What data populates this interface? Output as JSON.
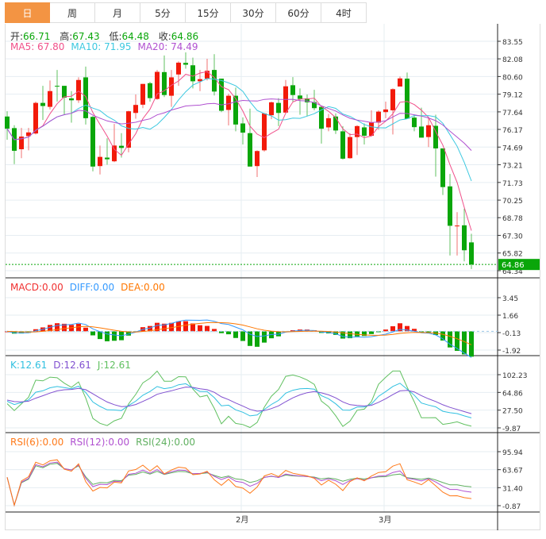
{
  "tabs": [
    {
      "label": "日",
      "active": true
    },
    {
      "label": "周"
    },
    {
      "label": "月"
    },
    {
      "label": "5分"
    },
    {
      "label": "15分"
    },
    {
      "label": "30分"
    },
    {
      "label": "60分"
    },
    {
      "label": "4时"
    }
  ],
  "ohlc_legend": {
    "open_label": "开:",
    "open": "66.71",
    "high_label": "高:",
    "high": "67.43",
    "low_label": "低:",
    "low": "64.48",
    "close_label": "收:",
    "close": "64.86"
  },
  "ma_legend": {
    "ma5": "MA5: 67.80",
    "ma10": "MA10: 71.95",
    "ma20": "MA20: 74.49"
  },
  "macd_legend": {
    "macd": "MACD:0.00",
    "diff": "DIFF:0.00",
    "dea": "DEA:0.00"
  },
  "kdj_legend": {
    "k": "K:12.61",
    "d": "D:12.61",
    "j": "J:12.61"
  },
  "rsi_legend": {
    "rsi6": "RSI(6):0.00",
    "rsi12": "RSI(12):0.00",
    "rsi24": "RSI(24):0.00"
  },
  "colors": {
    "up": "#f21a0a",
    "down": "#0aa60a",
    "accent": "#f39443",
    "ma5": "#f0508a",
    "ma10": "#3cc8e0",
    "ma20": "#b050d0",
    "diff": "#3399ff",
    "dea": "#ff7700",
    "k": "#30c0e0",
    "d": "#8050d0",
    "j": "#60c060",
    "rsi6": "#ff7a1a",
    "rsi12": "#b050d0",
    "rsi24": "#60b060"
  },
  "chart_data": {
    "type": "candlestick",
    "price_ticks": [
      "83.55",
      "82.08",
      "80.60",
      "79.12",
      "77.64",
      "76.17",
      "74.69",
      "73.21",
      "71.73",
      "70.25",
      "68.78",
      "67.30",
      "65.82",
      "64.34"
    ],
    "last_price": "64.86",
    "macd_ticks": [
      "3.45",
      "1.66",
      "-0.13",
      "-1.92"
    ],
    "kdj_ticks": [
      "102.23",
      "64.86",
      "27.50",
      "-9.87"
    ],
    "rsi_ticks": [
      "95.94",
      "63.67",
      "31.40",
      "-0.87"
    ],
    "x_ticks": [
      {
        "label": "2月",
        "index": 32
      },
      {
        "label": "3月",
        "index": 52
      }
    ],
    "candles": [
      [
        77.25,
        77.69,
        75.31,
        76.23
      ],
      [
        76.28,
        76.52,
        73.26,
        74.38
      ],
      [
        74.51,
        76.3,
        73.76,
        75.57
      ],
      [
        75.61,
        76.3,
        74.42,
        75.92
      ],
      [
        75.83,
        78.5,
        75.75,
        78.39
      ],
      [
        78.39,
        79.82,
        76.96,
        78.13
      ],
      [
        78.06,
        80.27,
        77.84,
        79.38
      ],
      [
        79.82,
        81.15,
        78.5,
        79.78
      ],
      [
        79.82,
        79.82,
        77.4,
        78.83
      ],
      [
        78.77,
        79.38,
        76.74,
        78.61
      ],
      [
        78.61,
        80.53,
        78.39,
        80.31
      ],
      [
        80.53,
        81.43,
        76.58,
        77.11
      ],
      [
        77.22,
        77.29,
        72.66,
        73.06
      ],
      [
        73.1,
        74.82,
        72.4,
        73.87
      ],
      [
        73.81,
        75.42,
        73.21,
        73.67
      ],
      [
        73.5,
        76.63,
        73.43,
        74.82
      ],
      [
        74.8,
        75.86,
        73.81,
        74.62
      ],
      [
        74.64,
        77.73,
        74.25,
        77.69
      ],
      [
        77.55,
        79.1,
        77.07,
        78.22
      ],
      [
        78.24,
        79.98,
        77.95,
        79.98
      ],
      [
        80.04,
        80.15,
        78.5,
        78.79
      ],
      [
        78.72,
        81.15,
        78.66,
        80.99
      ],
      [
        80.97,
        82.36,
        78.88,
        79.05
      ],
      [
        78.99,
        81.15,
        78.06,
        80.53
      ],
      [
        80.77,
        81.87,
        79.82,
        81.76
      ],
      [
        81.74,
        82.62,
        81.26,
        81.59
      ],
      [
        81.54,
        82.18,
        79.6,
        80.2
      ],
      [
        80.2,
        81.15,
        79.38,
        80.38
      ],
      [
        80.42,
        82.09,
        80.27,
        81.08
      ],
      [
        81.15,
        82.47,
        79.01,
        79.34
      ],
      [
        80.42,
        80.42,
        77.62,
        77.73
      ],
      [
        77.8,
        79.16,
        76.5,
        78.99
      ],
      [
        78.99,
        79.67,
        76.01,
        76.58
      ],
      [
        76.67,
        77.18,
        74.91,
        75.9
      ],
      [
        75.86,
        77.91,
        73.06,
        73.06
      ],
      [
        73.1,
        74.42,
        72.18,
        74.36
      ],
      [
        74.42,
        77.55,
        74.31,
        77.51
      ],
      [
        77.36,
        78.5,
        77.03,
        78.44
      ],
      [
        78.39,
        78.79,
        76.45,
        77.55
      ],
      [
        77.58,
        80.31,
        77.51,
        79.78
      ],
      [
        79.87,
        80.55,
        78.5,
        79.05
      ],
      [
        79.01,
        79.6,
        77.4,
        78.72
      ],
      [
        78.77,
        79.1,
        77.29,
        78.44
      ],
      [
        78.46,
        79.49,
        77.77,
        77.95
      ],
      [
        78.06,
        78.13,
        74.98,
        76.23
      ],
      [
        76.34,
        77.47,
        76.01,
        77.11
      ],
      [
        77.25,
        77.51,
        75.79,
        76.08
      ],
      [
        76.01,
        76.45,
        73.65,
        73.72
      ],
      [
        73.76,
        75.86,
        73.72,
        75.53
      ],
      [
        75.53,
        76.52,
        74.03,
        76.45
      ],
      [
        76.34,
        76.67,
        74.91,
        75.64
      ],
      [
        75.64,
        77.77,
        75.57,
        76.74
      ],
      [
        76.74,
        77.77,
        76.14,
        77.66
      ],
      [
        77.62,
        78.5,
        77.11,
        77.84
      ],
      [
        77.77,
        79.6,
        75.75,
        79.54
      ],
      [
        79.76,
        80.6,
        79.76,
        80.44
      ],
      [
        80.42,
        80.93,
        77.07,
        77.07
      ],
      [
        77.16,
        77.4,
        76.01,
        76.36
      ],
      [
        76.41,
        77.99,
        75.48,
        75.48
      ],
      [
        75.53,
        77.18,
        74.69,
        76.52
      ],
      [
        76.47,
        77.4,
        72.22,
        74.58
      ],
      [
        74.58,
        74.58,
        70.68,
        71.34
      ],
      [
        71.4,
        72.44,
        65.61,
        68.1
      ],
      [
        68.1,
        69.24,
        65.61,
        68.12
      ],
      [
        68.14,
        69.53,
        65.12,
        66.05
      ],
      [
        66.71,
        67.43,
        64.48,
        64.86
      ]
    ]
  }
}
